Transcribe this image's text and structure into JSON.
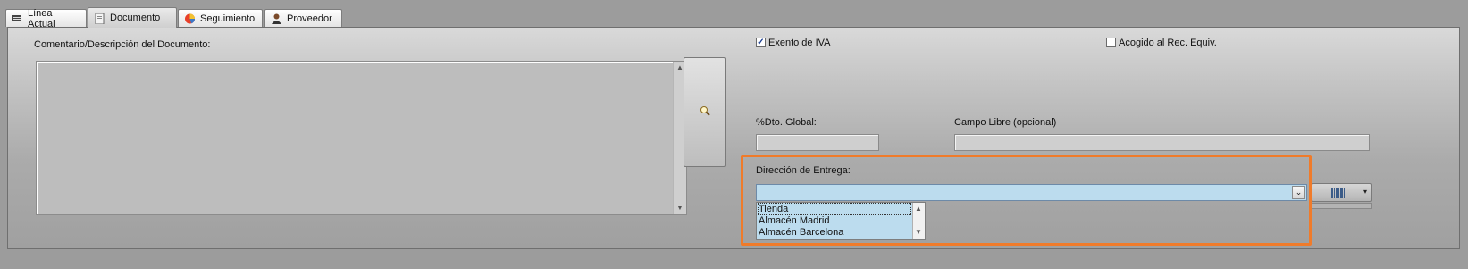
{
  "tabs": [
    {
      "label": "Línea Actual",
      "icon": "document-lines-icon"
    },
    {
      "label": "Documento",
      "icon": "document-icon"
    },
    {
      "label": "Seguimiento",
      "icon": "tracking-chart-icon"
    },
    {
      "label": "Proveedor",
      "icon": "supplier-person-icon"
    }
  ],
  "active_tab": "Documento",
  "comment": {
    "label": "Comentario/Descripción del Documento:",
    "value": "",
    "zoom_icon": "magnifier-icon"
  },
  "iva": {
    "label": "Exento de IVA",
    "checked": true
  },
  "rec_equiv": {
    "label": "Acogido al Rec. Equiv.",
    "checked": false
  },
  "discount": {
    "label": "%Dto. Global:",
    "value": ""
  },
  "free_field": {
    "label": "Campo Libre (opcional)",
    "value": ""
  },
  "delivery": {
    "label": "Dirección de Entrega:",
    "value": "",
    "options": [
      "Tienda",
      "Almacén Madrid",
      "Almacén Barcelona"
    ],
    "highlighted_option": "Tienda"
  },
  "tool_button_icon": "barcode-menu-icon",
  "colors": {
    "highlight": "#f07b2a",
    "combo_bg": "#bcdcee"
  }
}
